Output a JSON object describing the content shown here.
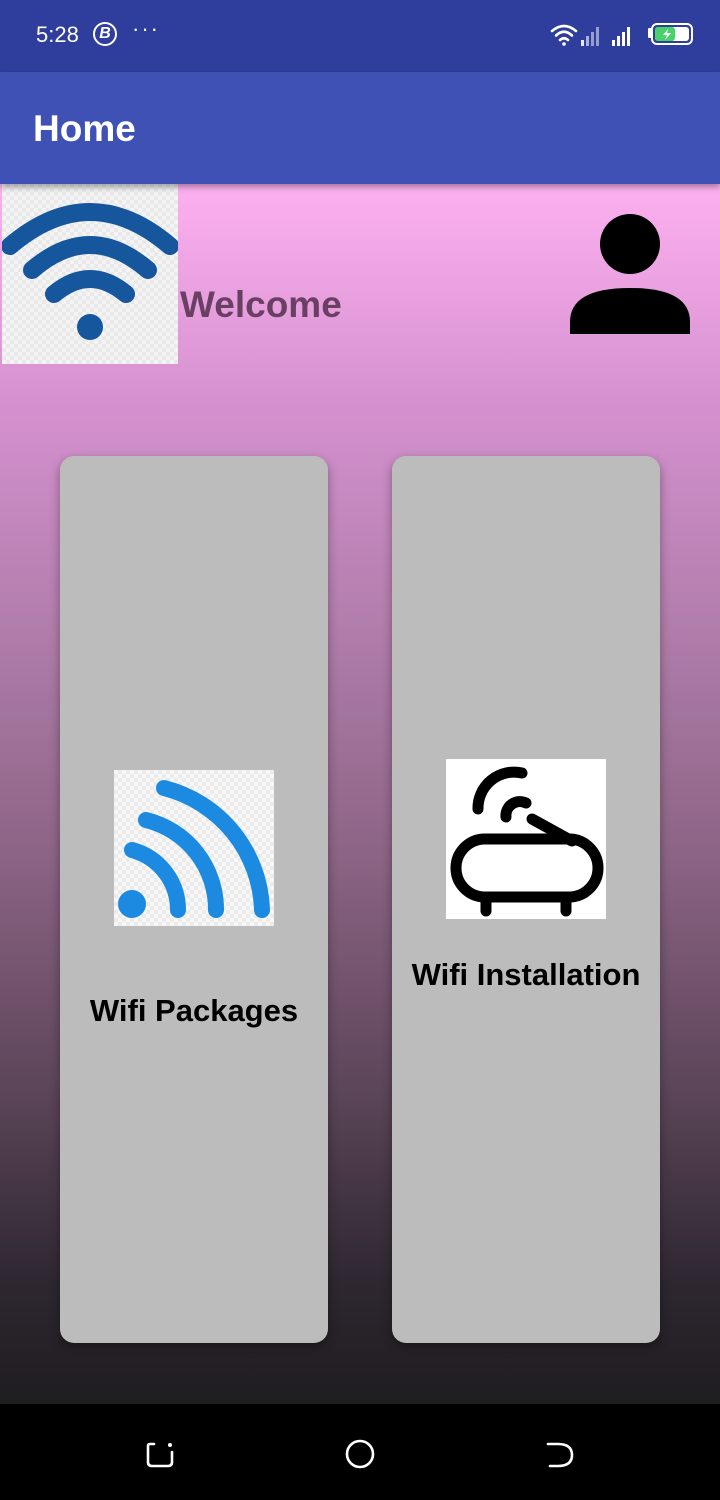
{
  "status_bar": {
    "time": "5:28",
    "badge": "B",
    "more": "···",
    "icons": [
      "wifi-icon",
      "signal-icon",
      "signal-icon",
      "battery-charging-icon"
    ]
  },
  "app_bar": {
    "title": "Home"
  },
  "header": {
    "logo_icon": "wifi-icon",
    "welcome_text": "Welcome",
    "profile_icon": "person-icon"
  },
  "cards": [
    {
      "icon": "wifi-signal-icon",
      "label": "Wifi Packages"
    },
    {
      "icon": "router-icon",
      "label": "Wifi Installation"
    }
  ],
  "nav_bar": {
    "buttons": [
      "recents-icon",
      "home-icon",
      "back-icon"
    ]
  },
  "colors": {
    "app_bar": "#3f51b5",
    "status_bar": "#2f3d9c",
    "card_bg": "#bdbcbd",
    "welcome": "#6a3f64",
    "wifi_blue": "#1b8ae0",
    "logo_blue": "#15569c"
  }
}
